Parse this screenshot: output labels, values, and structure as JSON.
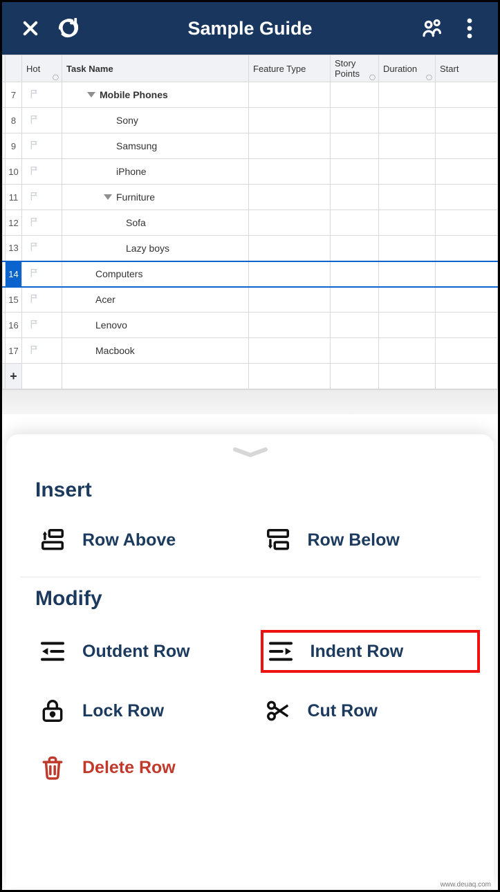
{
  "header": {
    "title": "Sample Guide"
  },
  "columns": {
    "hot": "Hot",
    "task": "Task Name",
    "feature_type": "Feature Type",
    "story_points": "Story Points",
    "duration": "Duration",
    "start": "Start"
  },
  "rows": [
    {
      "num": 7,
      "indent": 36,
      "label": "Mobile Phones",
      "bold": true,
      "caret": true,
      "selected": false
    },
    {
      "num": 8,
      "indent": 78,
      "label": "Sony",
      "bold": false,
      "caret": false,
      "selected": false
    },
    {
      "num": 9,
      "indent": 78,
      "label": "Samsung",
      "bold": false,
      "caret": false,
      "selected": false
    },
    {
      "num": 10,
      "indent": 78,
      "label": "iPhone",
      "bold": false,
      "caret": false,
      "selected": false
    },
    {
      "num": 11,
      "indent": 60,
      "label": "Furniture",
      "bold": false,
      "caret": true,
      "selected": false
    },
    {
      "num": 12,
      "indent": 92,
      "label": "Sofa",
      "bold": false,
      "caret": false,
      "selected": false
    },
    {
      "num": 13,
      "indent": 92,
      "label": "Lazy boys",
      "bold": false,
      "caret": false,
      "selected": false
    },
    {
      "num": 14,
      "indent": 48,
      "label": "Computers",
      "bold": false,
      "caret": false,
      "selected": true
    },
    {
      "num": 15,
      "indent": 48,
      "label": "Acer",
      "bold": false,
      "caret": false,
      "selected": false
    },
    {
      "num": 16,
      "indent": 48,
      "label": "Lenovo",
      "bold": false,
      "caret": false,
      "selected": false
    },
    {
      "num": 17,
      "indent": 48,
      "label": "Macbook",
      "bold": false,
      "caret": false,
      "selected": false
    }
  ],
  "add_row_symbol": "+",
  "sheet": {
    "insert_title": "Insert",
    "modify_title": "Modify",
    "actions": {
      "row_above": "Row Above",
      "row_below": "Row Below",
      "outdent": "Outdent Row",
      "indent": "Indent Row",
      "lock": "Lock Row",
      "cut": "Cut Row",
      "delete": "Delete Row"
    },
    "highlighted_action": "indent"
  },
  "watermark": "www.deuaq.com"
}
